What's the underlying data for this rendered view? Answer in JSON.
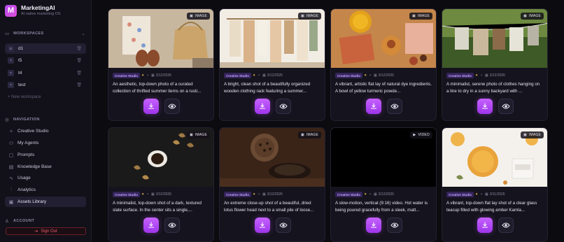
{
  "brand": {
    "name": "MarketingAI",
    "tagline": "AI native marketing OS",
    "logo_letter": "M"
  },
  "workspaces": {
    "heading": "WORKSPACES",
    "items": [
      {
        "badge": "D",
        "label": "d1",
        "active": true
      },
      {
        "badge": "T",
        "label": "t5",
        "active": false
      },
      {
        "badge": "T",
        "label": "t4",
        "active": false
      },
      {
        "badge": "T",
        "label": "test",
        "active": false
      }
    ],
    "new_label": "+ New workspace"
  },
  "navigation": {
    "heading": "NAVIGATION",
    "items": [
      {
        "icon": "sparkle-icon",
        "label": "Creative Studio"
      },
      {
        "icon": "users-icon",
        "label": "My Agents"
      },
      {
        "icon": "chat-icon",
        "label": "Prompts"
      },
      {
        "icon": "book-icon",
        "label": "Knowledge Base"
      },
      {
        "icon": "pulse-icon",
        "label": "Usage"
      },
      {
        "icon": "chart-icon",
        "label": "Analytics"
      },
      {
        "icon": "image-icon",
        "label": "Assets Library",
        "active": true
      }
    ]
  },
  "account": {
    "heading": "ACCOUNT",
    "signout_label": "Sign Out"
  },
  "assets": [
    {
      "type": "IMAGE",
      "tag": "Creative Studio",
      "date": "3/12/2026",
      "description": "An aesthetic, top-down photo of a curated collection of thrifted summer items on a rusti..."
    },
    {
      "type": "IMAGE",
      "tag": "Creative Studio",
      "date": "3/12/2026",
      "description": "A bright, clean shot of a beautifully organized wooden clothing rack featuring a summer..."
    },
    {
      "type": "IMAGE",
      "tag": "Creative Studio",
      "date": "3/12/2026",
      "description": "A vibrant, artistic flat lay of natural dye ingredients. A bowl of yellow turmeric powde..."
    },
    {
      "type": "IMAGE",
      "tag": "Creative Studio",
      "date": "3/12/2026",
      "description": "A minimalist, serene photo of clothes hanging on a line to dry in a sunny backyard with ..."
    },
    {
      "type": "IMAGE",
      "tag": "Creative Studio",
      "date": "3/12/2026",
      "description": "A minimalist, top-down shot of a dark, textured slate surface. In the center sits a single,..."
    },
    {
      "type": "IMAGE",
      "tag": "Creative Studio",
      "date": "3/12/2026",
      "description": "An extreme close-up shot of a beautiful, dried lotus flower head next to a small pile of loose..."
    },
    {
      "type": "VIDEO",
      "tag": "Creative Studio",
      "date": "3/12/2026",
      "description": "A slow-motion, vertical (9:16) video. Hot water is being poured gracefully from a sleek, matt..."
    },
    {
      "type": "IMAGE",
      "tag": "Creative Studio",
      "date": "3/11/2026",
      "description": "A vibrant, top-down flat lay shot of a clear glass teacup filled with glowing amber Kamla..."
    }
  ],
  "colors": {
    "accent": "#b44cf0",
    "signout": "#ef5a6b",
    "tag_bg": "#34245a",
    "tag_text": "#c6a6ff"
  }
}
